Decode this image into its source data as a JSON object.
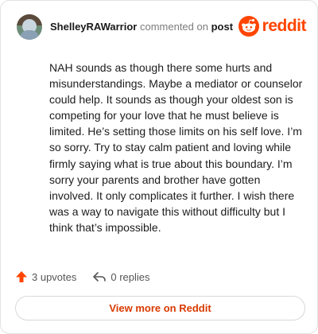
{
  "header": {
    "username": "ShelleyRAWarrior",
    "verb": "commented on",
    "post_link": "post",
    "brand": "reddit"
  },
  "comment": {
    "text": "NAH sounds as though there some hurts and misunderstandings. Maybe a mediator or counselor could help. It sounds as though your oldest son is competing for your love that he must believe is limited. He’s setting those limits on his self love. I’m so sorry. Try to stay calm patient and loving while firmly saying what is true about this boundary. I’m sorry your parents and brother have gotten involved. It only complicates it further. I wish there was a way to navigate this without difficulty but I think that’s impossible."
  },
  "actions": {
    "upvotes": "3 upvotes",
    "replies": "0 replies"
  },
  "footer": {
    "view_more": "View more on Reddit"
  },
  "colors": {
    "brand": "#ff4500",
    "link": "#d93a00"
  }
}
